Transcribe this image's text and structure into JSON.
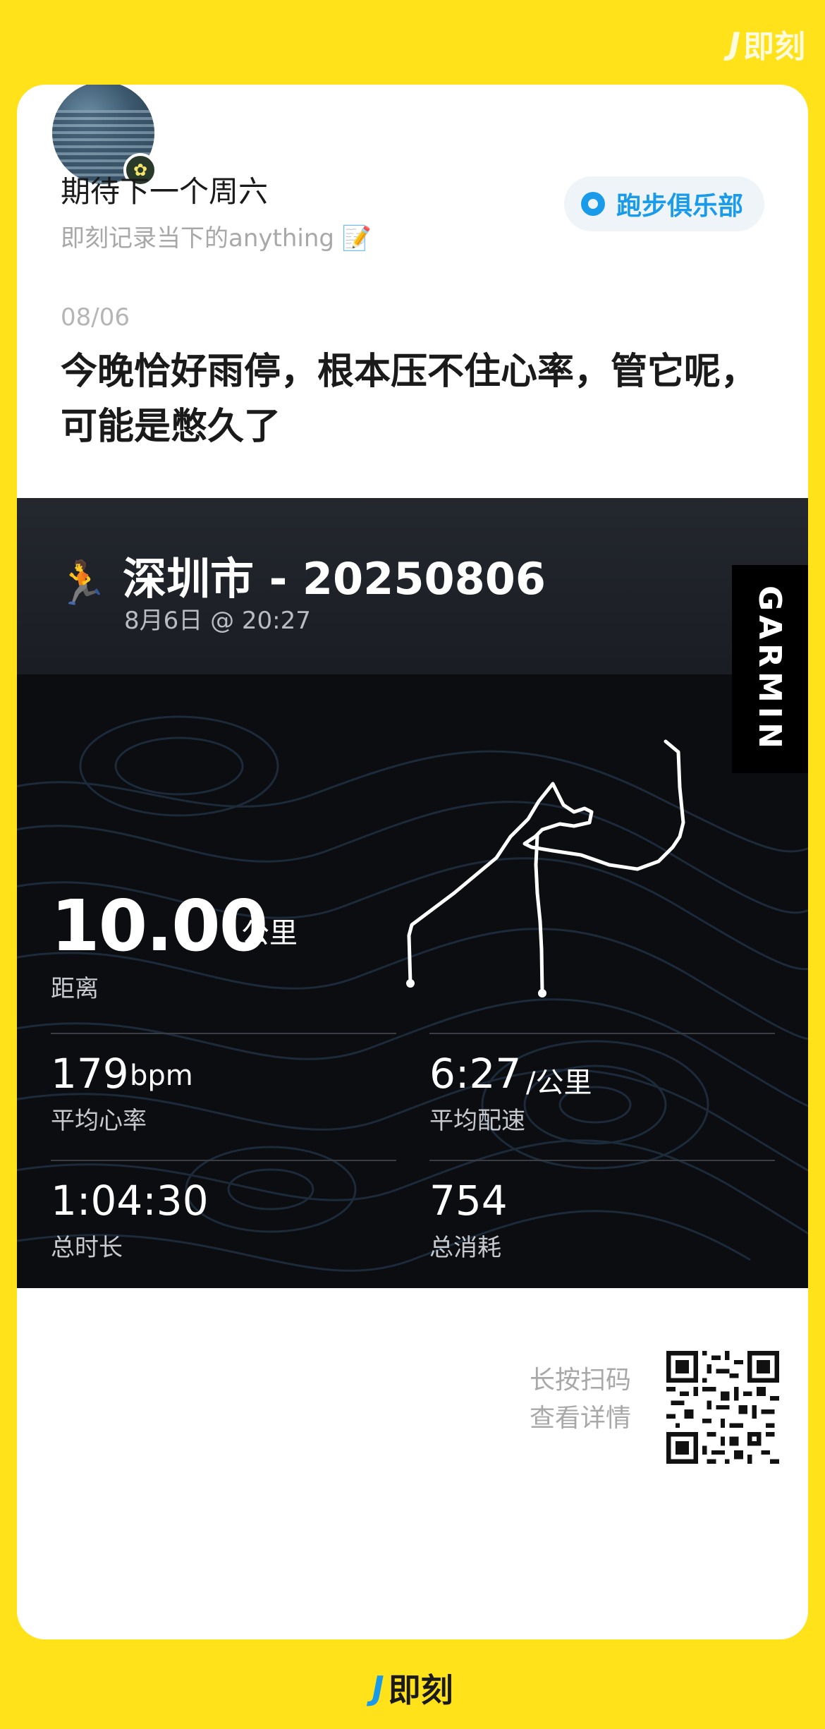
{
  "brand": {
    "name": "即刻",
    "mark": "J"
  },
  "post": {
    "user_name": "期待下一个周六",
    "user_tagline": "即刻记录当下的anything 📝",
    "club": "跑步俱乐部",
    "date": "08/06",
    "text": "今晚恰好雨停，根本压不住心率，管它呢，可能是憋久了"
  },
  "activity": {
    "title": "深圳市 - 20250806",
    "subtitle": "8月6日 @ 20:27",
    "provider": "GARMIN",
    "distance": {
      "value": "10.00",
      "unit": "公里",
      "label": "距离"
    },
    "heart_rate": {
      "value": "179",
      "unit": "bpm",
      "label": "平均心率"
    },
    "pace": {
      "value": "6:27",
      "unit": "/公里",
      "label": "平均配速"
    },
    "duration": {
      "value": "1:04:30",
      "label": "总时长"
    },
    "calories": {
      "value": "754",
      "label": "总消耗"
    }
  },
  "share": {
    "scan_line1": "长按扫码",
    "scan_line2": "查看详情"
  },
  "colors": {
    "background": "#FFE21A",
    "accent": "#1A9BEA",
    "activity_bg": "#0b0d11"
  },
  "icons": [
    "run-icon",
    "club-icon",
    "qr-code",
    "avatar-badge-icon"
  ]
}
